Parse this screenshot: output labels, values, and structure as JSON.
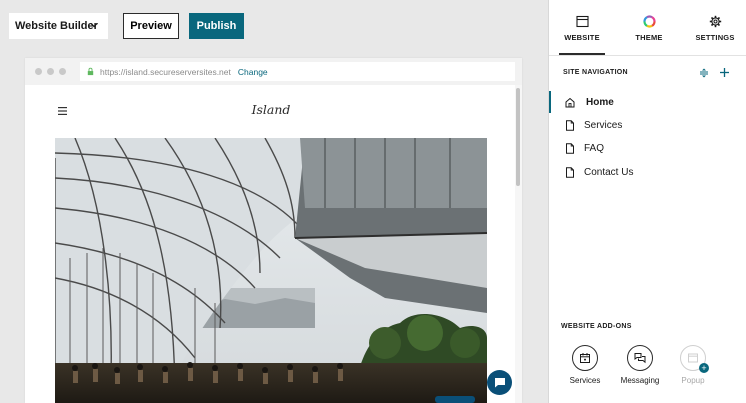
{
  "toolbar": {
    "builder_label": "Website Builder",
    "preview_label": "Preview",
    "publish_label": "Publish"
  },
  "browser": {
    "url": "https://island.secureserversites.net",
    "change_label": "Change"
  },
  "site": {
    "title": "Island"
  },
  "panel": {
    "tabs": [
      {
        "label": "WEBSITE",
        "icon": "browser-window-icon",
        "active": true
      },
      {
        "label": "THEME",
        "icon": "color-wheel-icon",
        "active": false
      },
      {
        "label": "SETTINGS",
        "icon": "gear-icon",
        "active": false
      }
    ],
    "site_navigation_title": "SITE NAVIGATION",
    "nav_items": [
      {
        "label": "Home",
        "icon": "home-icon",
        "active": true
      },
      {
        "label": "Services",
        "icon": "page-icon",
        "active": false
      },
      {
        "label": "FAQ",
        "icon": "page-icon",
        "active": false
      },
      {
        "label": "Contact Us",
        "icon": "page-icon",
        "active": false
      }
    ],
    "addons_title": "WEBSITE ADD-ONS",
    "addons": [
      {
        "label": "Services",
        "icon": "calendar-icon",
        "enabled": true
      },
      {
        "label": "Messaging",
        "icon": "chat-bubbles-icon",
        "enabled": true
      },
      {
        "label": "Popup",
        "icon": "popup-window-icon",
        "enabled": false
      }
    ]
  },
  "colors": {
    "accent": "#09677d",
    "chat_button": "#0a4f78",
    "background": "#e8e8e8"
  }
}
